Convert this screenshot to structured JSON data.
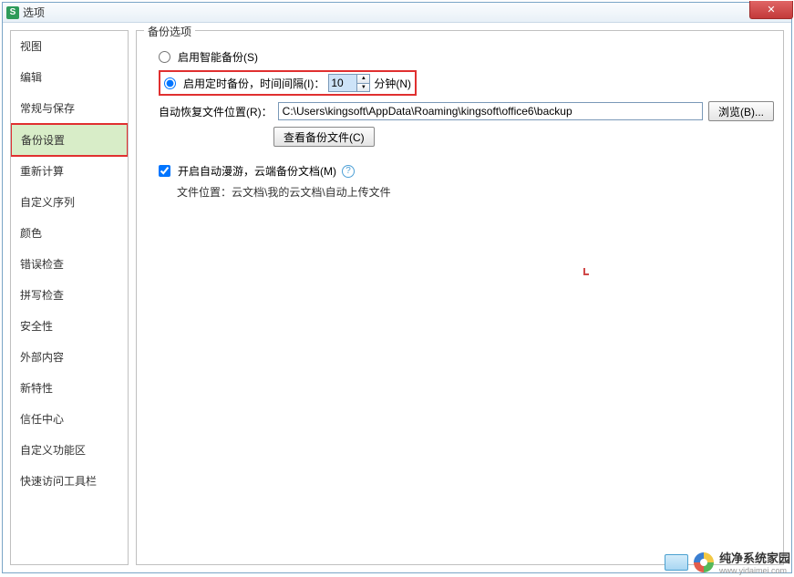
{
  "window": {
    "title": "选项",
    "icon_letter": "S"
  },
  "sidebar": {
    "items": [
      {
        "label": "视图"
      },
      {
        "label": "编辑"
      },
      {
        "label": "常规与保存"
      },
      {
        "label": "备份设置",
        "selected": true
      },
      {
        "label": "重新计算"
      },
      {
        "label": "自定义序列"
      },
      {
        "label": "颜色"
      },
      {
        "label": "错误检查"
      },
      {
        "label": "拼写检查"
      },
      {
        "label": "安全性"
      },
      {
        "label": "外部内容"
      },
      {
        "label": "新特性"
      },
      {
        "label": "信任中心"
      },
      {
        "label": "自定义功能区"
      },
      {
        "label": "快速访问工具栏"
      }
    ]
  },
  "main": {
    "group_title": "备份选项",
    "smart_backup_label": "启用智能备份(S)",
    "timed_backup_label": "启用定时备份，时间间隔(I)：",
    "interval_value": "10",
    "interval_unit": "分钟(N)",
    "recover_path_label": "自动恢复文件位置(R)：",
    "recover_path_value": "C:\\Users\\kingsoft\\AppData\\Roaming\\kingsoft\\office6\\backup",
    "browse_label": "浏览(B)...",
    "view_backup_btn": "查看备份文件(C)",
    "auto_roam_label": "开启自动漫游，云端备份文档(M)",
    "file_location_label": "文件位置：云文档\\我的云文档\\自动上传文件"
  },
  "footer": {
    "brand": "纯净系统家园",
    "url": "www.yidaimei.com"
  }
}
